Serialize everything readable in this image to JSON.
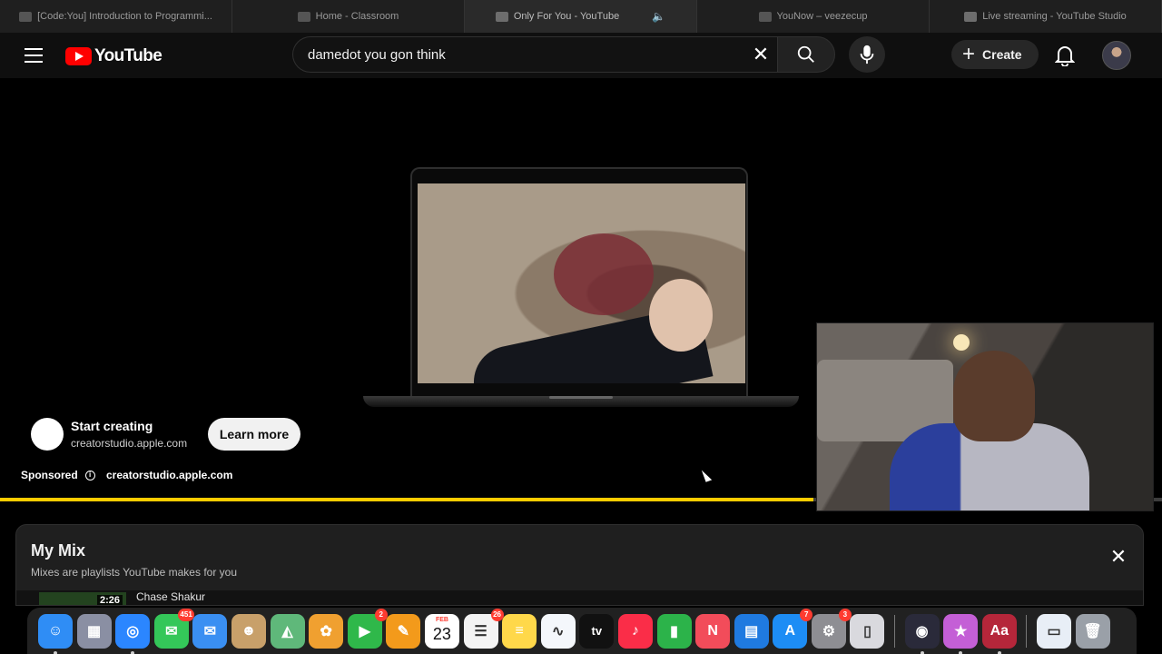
{
  "browser": {
    "tabs": [
      {
        "title": "[Code:You] Introduction to Programmi...",
        "active": false
      },
      {
        "title": "Home - Classroom",
        "active": false
      },
      {
        "title": "Only For You - YouTube",
        "active": true
      },
      {
        "title": "YouNow – veezecup",
        "active": false
      },
      {
        "title": "Live streaming - YouTube Studio",
        "active": false
      }
    ]
  },
  "header": {
    "logo_text": "YouTube",
    "search_value": "damedot you gon think",
    "create_label": "Create"
  },
  "ad": {
    "headline": "Start creating",
    "domain": "creatorstudio.apple.com",
    "cta_label": "Learn more",
    "sponsored_label": "Sponsored",
    "sponsored_url": "creatorstudio.apple.com",
    "progress_fraction": 0.7
  },
  "mix": {
    "title": "My Mix",
    "subtitle": "Mixes are playlists YouTube makes for you",
    "first_item": {
      "duration": "2:26",
      "channel": "Chase Shakur"
    }
  },
  "dock": {
    "apps": [
      {
        "name": "finder",
        "badge": null,
        "color": "#2f8df5",
        "glyph": "☺",
        "running": true
      },
      {
        "name": "launchpad",
        "badge": null,
        "color": "#8a8fa3",
        "glyph": "▦",
        "running": false
      },
      {
        "name": "safari",
        "badge": null,
        "color": "#2b86ff",
        "glyph": "◎",
        "running": true
      },
      {
        "name": "messages",
        "badge": "451",
        "color": "#34c759",
        "glyph": "✉",
        "running": false
      },
      {
        "name": "mail",
        "badge": null,
        "color": "#3a8ff2",
        "glyph": "✉",
        "running": false
      },
      {
        "name": "contacts",
        "badge": null,
        "color": "#c8a06a",
        "glyph": "☻",
        "running": false
      },
      {
        "name": "maps",
        "badge": null,
        "color": "#5fb87a",
        "glyph": "◭",
        "running": false
      },
      {
        "name": "photos",
        "badge": null,
        "color": "#f0a030",
        "glyph": "✿",
        "running": false
      },
      {
        "name": "facetime",
        "badge": "2",
        "color": "#2fb84a",
        "glyph": "▶",
        "running": false
      },
      {
        "name": "pages",
        "badge": null,
        "color": "#f39a1b",
        "glyph": "✎",
        "running": false
      },
      {
        "name": "calendar",
        "badge": null,
        "color": "#ffffff",
        "glyph": "",
        "month": "FEB",
        "day": "23",
        "running": false
      },
      {
        "name": "reminders",
        "badge": "26",
        "color": "#f4f4f4",
        "glyph": "☰",
        "running": false
      },
      {
        "name": "notes",
        "badge": null,
        "color": "#ffd84a",
        "glyph": "≡",
        "running": false
      },
      {
        "name": "freeform",
        "badge": null,
        "color": "#f4f7fb",
        "glyph": "∿",
        "running": false
      },
      {
        "name": "tv",
        "badge": null,
        "color": "#111111",
        "glyph": "tv",
        "running": false
      },
      {
        "name": "music",
        "badge": null,
        "color": "#fa2d48",
        "glyph": "♪",
        "running": false
      },
      {
        "name": "numbers",
        "badge": null,
        "color": "#2cb34a",
        "glyph": "▮",
        "running": false
      },
      {
        "name": "news",
        "badge": null,
        "color": "#f24c5a",
        "glyph": "N",
        "running": false
      },
      {
        "name": "keynote",
        "badge": null,
        "color": "#1f7ae0",
        "glyph": "▤",
        "running": false
      },
      {
        "name": "app-store",
        "badge": "7",
        "color": "#1d8df5",
        "glyph": "A",
        "running": false
      },
      {
        "name": "system-settings",
        "badge": "3",
        "color": "#8e8e93",
        "glyph": "⚙",
        "running": false
      },
      {
        "name": "iphone-mirroring",
        "badge": null,
        "color": "#d9d9de",
        "glyph": "▯",
        "running": false
      },
      {
        "name": "obs",
        "badge": null,
        "color": "#2a2a3a",
        "glyph": "◉",
        "running": true
      },
      {
        "name": "feedback",
        "badge": null,
        "color": "#c45fd6",
        "glyph": "★",
        "running": true
      },
      {
        "name": "dictionary",
        "badge": null,
        "color": "#b5263a",
        "glyph": "Aa",
        "running": true
      },
      {
        "name": "preview-doc",
        "badge": null,
        "color": "#e8eef6",
        "glyph": "▭",
        "running": false
      },
      {
        "name": "trash",
        "badge": null,
        "color": "#9aa0a8",
        "glyph": "🗑",
        "running": false
      }
    ]
  }
}
